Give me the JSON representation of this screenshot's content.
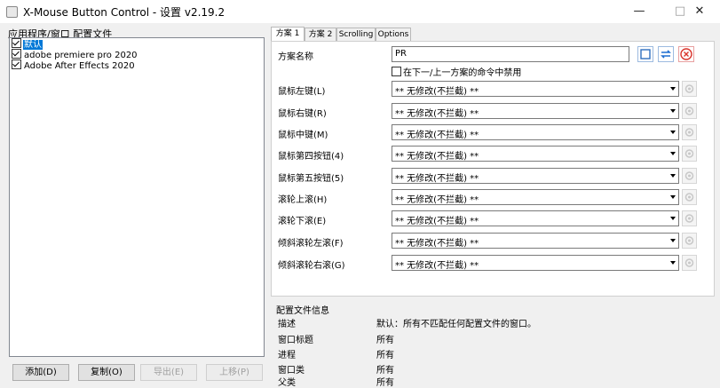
{
  "window": {
    "title": "X-Mouse Button Control - 设置 v2.19.2",
    "minimize": "—",
    "maximize": "□",
    "close": "✕"
  },
  "left": {
    "label": "应用程序/窗口 配置文件",
    "profiles": [
      {
        "name": "默认",
        "checked": true,
        "selected": true
      },
      {
        "name": "adobe premiere pro 2020",
        "checked": true,
        "selected": false
      },
      {
        "name": "Adobe After Effects 2020",
        "checked": true,
        "selected": false
      }
    ],
    "buttons": {
      "add": "添加(D)",
      "copy": "复制(O)",
      "export": "导出(E)",
      "moveup": "上移(P)"
    }
  },
  "tabs": [
    "方案 1",
    "方案 2",
    "Scrolling",
    "Options"
  ],
  "scheme": {
    "name_label": "方案名称",
    "name_value": "PR",
    "disable_label": "在下一/上一方案的命令中禁用",
    "rows": [
      {
        "label": "鼠标左键(L)",
        "value": "** 无修改(不拦截) **"
      },
      {
        "label": "鼠标右键(R)",
        "value": "** 无修改(不拦截) **"
      },
      {
        "label": "鼠标中键(M)",
        "value": "** 无修改(不拦截) **"
      },
      {
        "label": "鼠标第四按钮(4)",
        "value": "** 无修改(不拦截) **"
      },
      {
        "label": "鼠标第五按钮(5)",
        "value": "** 无修改(不拦截) **"
      },
      {
        "label": "滚轮上滚(H)",
        "value": "** 无修改(不拦截) **"
      },
      {
        "label": "滚轮下滚(E)",
        "value": "** 无修改(不拦截) **"
      },
      {
        "label": "倾斜滚轮左滚(F)",
        "value": "** 无修改(不拦截) **"
      },
      {
        "label": "倾斜滚轮右滚(G)",
        "value": "** 无修改(不拦截) **"
      }
    ]
  },
  "info": {
    "title": "配置文件信息",
    "rows": [
      {
        "key": "描述",
        "value": "默认：所有不匹配任何配置文件的窗口。"
      },
      {
        "key": "窗口标题",
        "value": "所有"
      },
      {
        "key": "进程",
        "value": "所有"
      },
      {
        "key": "窗口类",
        "value": "所有"
      },
      {
        "key": "父类",
        "value": "所有"
      }
    ]
  }
}
